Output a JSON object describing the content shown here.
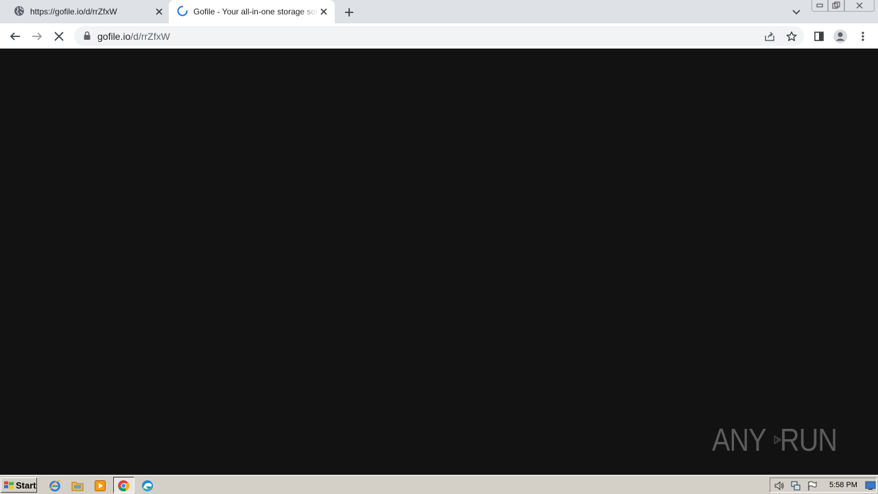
{
  "browser": {
    "tabs": [
      {
        "title": "https://gofile.io/d/rrZfxW",
        "icon": "globe-icon",
        "active": false
      },
      {
        "title": "Gofile - Your all-in-one storage solution",
        "icon": "loading-spinner-icon",
        "active": true
      }
    ],
    "address": {
      "host": "gofile.io",
      "path": "/d/rrZfxW"
    }
  },
  "watermark": {
    "left": "ANY",
    "right": "RUN"
  },
  "taskbar": {
    "start_label": "Start",
    "clock": "5:58 PM"
  },
  "colors": {
    "page_background": "#121212",
    "tabstrip": "#dee1e6",
    "spinner": "#1a73e8",
    "taskbar": "#d4d0c8"
  }
}
